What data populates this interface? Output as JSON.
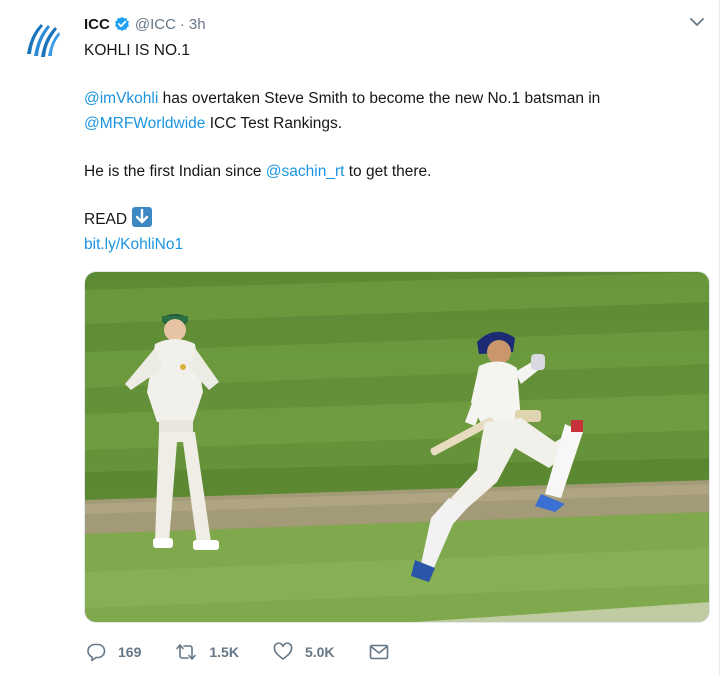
{
  "author": {
    "name": "ICC",
    "handle": "@ICC",
    "separator": "·",
    "time": "3h",
    "avatar_icon": "icc-logo-icon",
    "verified_icon": "verified-badge-icon"
  },
  "tweet": {
    "headline": "KOHLI IS NO.1",
    "mention_kohli": "@imVkohli",
    "text_1a": " has overtaken Steve Smith to become the new No.1 batsman in",
    "mention_mrf": "@MRFWorldwide",
    "text_1b": " ICC Test Rankings.",
    "text_2a": "He is the first Indian since ",
    "mention_sachin": "@sachin_rt",
    "text_2b": " to get there.",
    "read_label": "READ",
    "read_emoji_icon": "down-arrow-emoji-icon",
    "link": "bit.ly/KohliNo1"
  },
  "media": {
    "image_icon": "cricket-photo-image"
  },
  "actions": {
    "replies": "169",
    "retweets": "1.5K",
    "likes": "5.0K",
    "reply_icon": "reply-icon",
    "retweet_icon": "retweet-icon",
    "like_icon": "heart-icon",
    "message_icon": "envelope-icon"
  },
  "colors": {
    "link": "#1b95e0",
    "muted": "#657786",
    "verified": "#1da1f2",
    "grass_light": "#6d9a3c",
    "grass_dark": "#4f7f2b"
  }
}
